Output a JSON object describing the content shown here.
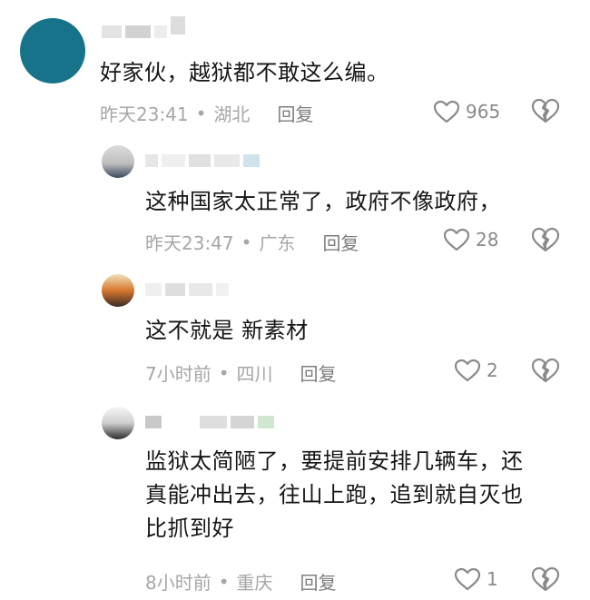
{
  "comments": [
    {
      "text": "好家伙，越狱都不敢这么编。",
      "time": "昨天23:41",
      "location": "湖北",
      "reply_label": "回复",
      "likes": "965"
    },
    {
      "text": "这种国家太正常了，政府不像政府，",
      "time": "昨天23:47",
      "location": "广东",
      "reply_label": "回复",
      "likes": "28"
    },
    {
      "text": "这不就是 新素材",
      "time": "7小时前",
      "location": "四川",
      "reply_label": "回复",
      "likes": "2"
    },
    {
      "text_lines": [
        "监狱太简陋了，要提前安排几辆车，还",
        "真能冲出去，往山上跑，追到就自灭也",
        "比抓到好"
      ],
      "time": "8小时前",
      "location": "重庆",
      "reply_label": "回复",
      "likes": "1"
    }
  ],
  "separator": "•",
  "icons": {
    "like": "heart-outline-icon",
    "dislike": "broken-heart-icon"
  },
  "colors": {
    "main_avatar": "#17738a",
    "meta_text": "#a6a6a6",
    "icon_stroke": "#8a8a8a"
  }
}
